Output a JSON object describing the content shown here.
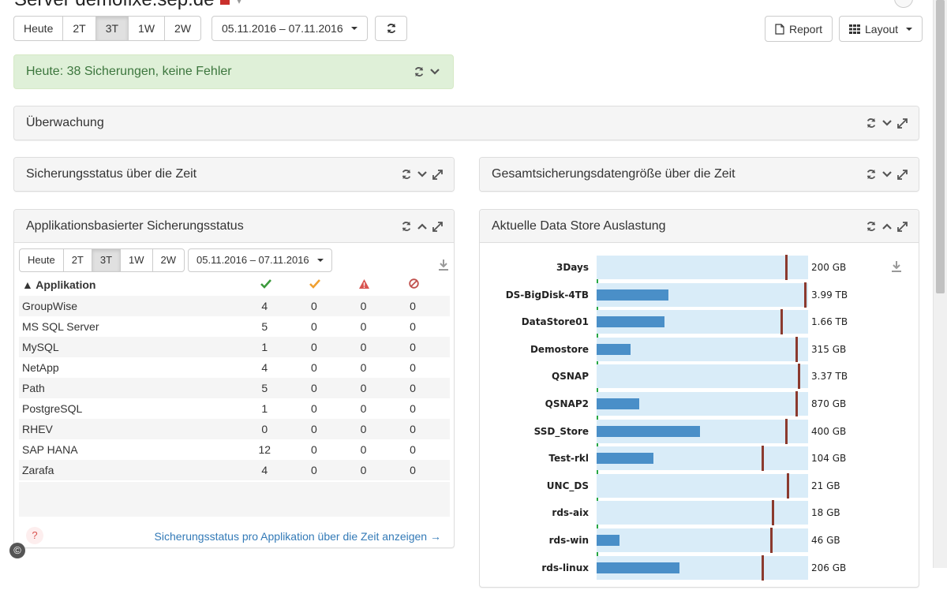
{
  "page": {
    "title": "Server demofixe.sep.de"
  },
  "toolbar": {
    "ranges": [
      "Heute",
      "2T",
      "3T",
      "1W",
      "2W"
    ],
    "active_range": "3T",
    "date_range": "05.11.2016 – 07.11.2016",
    "report_label": "Report",
    "layout_label": "Layout"
  },
  "alert": {
    "text": "Heute: 38 Sicherungen, keine Fehler"
  },
  "panels": {
    "ueberwachung": "Überwachung",
    "status_time": "Sicherungsstatus über die Zeit",
    "size_time": "Gesamtsicherungsdatengröße über die Zeit",
    "app_status": "Applikationsbasierter Sicherungsstatus",
    "datastore": "Aktuelle Data Store Auslastung"
  },
  "app_toolbar": {
    "ranges": [
      "Heute",
      "2T",
      "3T",
      "1W",
      "2W"
    ],
    "active_range": "3T",
    "date_range": "05.11.2016 – 07.11.2016"
  },
  "app_table": {
    "header": "▲ Applikation",
    "rows": [
      {
        "name": "GroupWise",
        "ok": "4",
        "warn": "0",
        "err": "0",
        "cancel": "0"
      },
      {
        "name": "MS SQL Server",
        "ok": "5",
        "warn": "0",
        "err": "0",
        "cancel": "0"
      },
      {
        "name": "MySQL",
        "ok": "1",
        "warn": "0",
        "err": "0",
        "cancel": "0"
      },
      {
        "name": "NetApp",
        "ok": "4",
        "warn": "0",
        "err": "0",
        "cancel": "0"
      },
      {
        "name": "Path",
        "ok": "5",
        "warn": "0",
        "err": "0",
        "cancel": "0"
      },
      {
        "name": "PostgreSQL",
        "ok": "1",
        "warn": "0",
        "err": "0",
        "cancel": "0"
      },
      {
        "name": "RHEV",
        "ok": "0",
        "warn": "0",
        "err": "0",
        "cancel": "0"
      },
      {
        "name": "SAP HANA",
        "ok": "12",
        "warn": "0",
        "err": "0",
        "cancel": "0"
      },
      {
        "name": "Zarafa",
        "ok": "4",
        "warn": "0",
        "err": "0",
        "cancel": "0"
      }
    ],
    "help": "?",
    "link": "Sicherungsstatus pro Applikation über die Zeit anzeigen →"
  },
  "datastores": [
    {
      "name": "3Days",
      "used": 0.0,
      "mark": 0.89,
      "value": "200 GB"
    },
    {
      "name": "DS-BigDisk-4TB",
      "used": 0.34,
      "mark": 0.98,
      "value": "3.99 TB"
    },
    {
      "name": "DataStore01",
      "used": 0.32,
      "mark": 0.87,
      "value": "1.66 TB"
    },
    {
      "name": "Demostore",
      "used": 0.16,
      "mark": 0.94,
      "value": "315 GB"
    },
    {
      "name": "QSNAP",
      "used": 0.0,
      "mark": 0.95,
      "value": "3.37 TB"
    },
    {
      "name": "QSNAP2",
      "used": 0.2,
      "mark": 0.94,
      "value": "870 GB"
    },
    {
      "name": "SSD_Store",
      "used": 0.49,
      "mark": 0.89,
      "value": "400 GB"
    },
    {
      "name": "Test-rkl",
      "used": 0.27,
      "mark": 0.78,
      "value": "104 GB"
    },
    {
      "name": "UNC_DS",
      "used": 0.0,
      "mark": 0.9,
      "value": "21 GB"
    },
    {
      "name": "rds-aix",
      "used": 0.0,
      "mark": 0.83,
      "value": "18 GB"
    },
    {
      "name": "rds-win",
      "used": 0.11,
      "mark": 0.82,
      "value": "46 GB"
    },
    {
      "name": "rds-linux",
      "used": 0.39,
      "mark": 0.78,
      "value": "206 GB"
    }
  ],
  "colors": {
    "ok": "#3c9a3c",
    "warn": "#f0a030",
    "err": "#d9534f",
    "cancel": "#c0504d",
    "bar_track": "#d9ecf8",
    "bar_fill": "#4a8fc8",
    "bar_mark": "#8b3a2e"
  }
}
